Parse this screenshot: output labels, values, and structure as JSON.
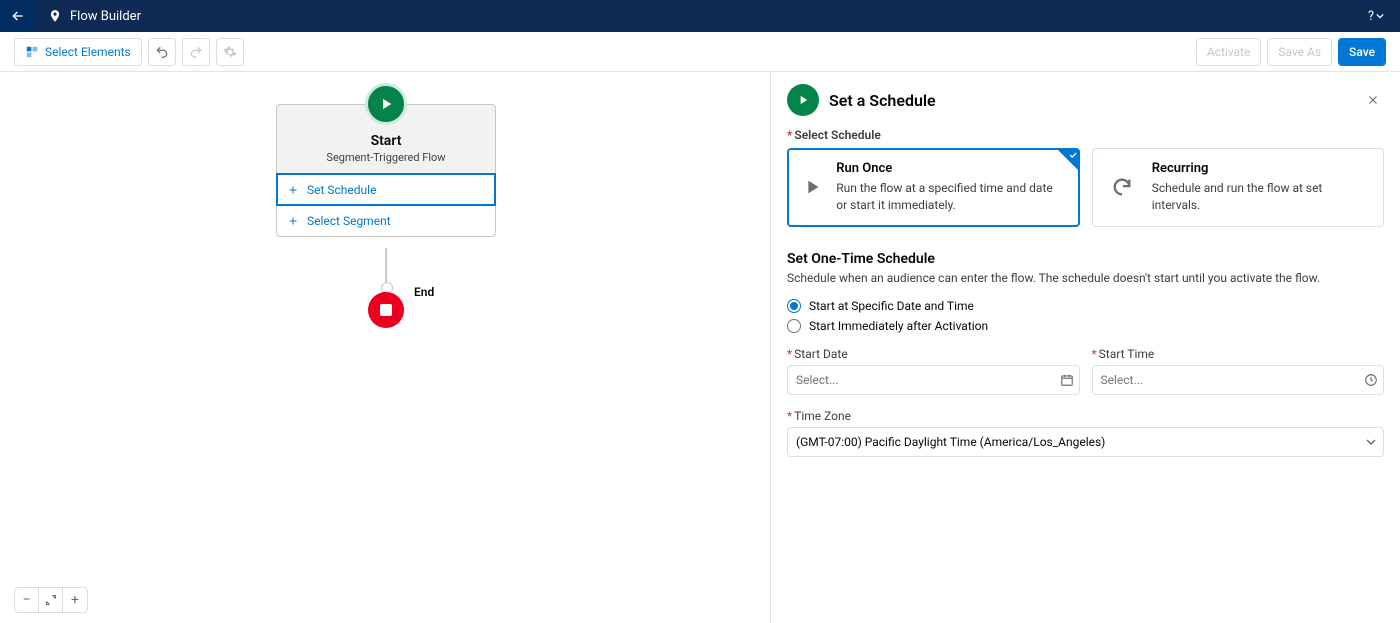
{
  "header": {
    "title": "Flow Builder"
  },
  "toolbar": {
    "select_elements": "Select Elements",
    "activate": "Activate",
    "save_as": "Save As",
    "save": "Save"
  },
  "canvas": {
    "start": {
      "title": "Start",
      "subtitle": "Segment-Triggered Flow",
      "actions": {
        "set_schedule": "Set Schedule",
        "select_segment": "Select Segment"
      }
    },
    "end_label": "End"
  },
  "panel": {
    "title": "Set a Schedule",
    "select_schedule_label": "Select Schedule",
    "options": {
      "run_once": {
        "title": "Run Once",
        "desc": "Run the flow at a specified time and date or start it immediately."
      },
      "recurring": {
        "title": "Recurring",
        "desc": "Schedule and run the flow at set intervals."
      }
    },
    "onetime": {
      "title": "Set One-Time Schedule",
      "desc": "Schedule when an audience can enter the flow. The schedule doesn't start until you activate the flow.",
      "radio_specific": "Start at Specific Date and Time",
      "radio_immediate": "Start Immediately after Activation"
    },
    "fields": {
      "start_date_label": "Start Date",
      "start_date_placeholder": "Select...",
      "start_time_label": "Start Time",
      "start_time_placeholder": "Select...",
      "timezone_label": "Time Zone",
      "timezone_value": "(GMT-07:00) Pacific Daylight Time (America/Los_Angeles)"
    }
  }
}
